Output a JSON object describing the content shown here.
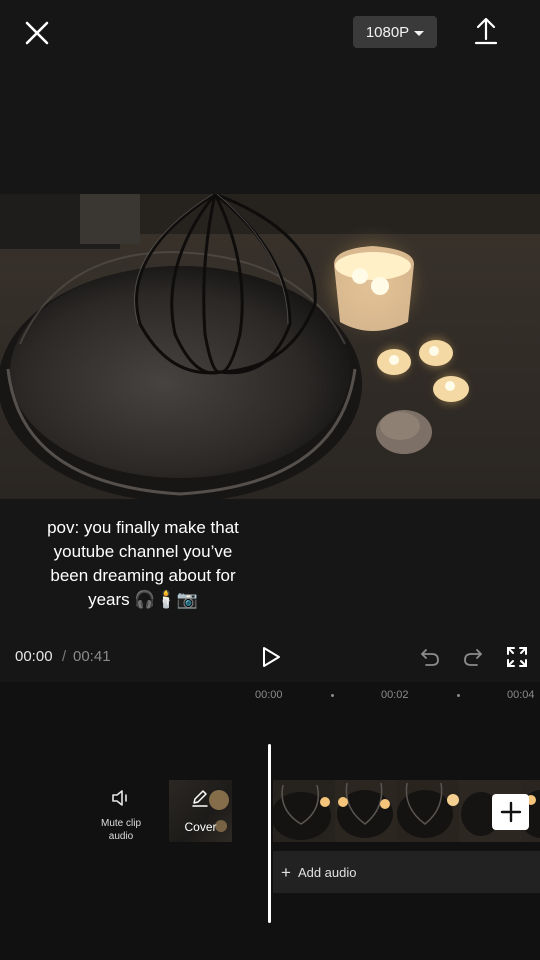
{
  "top_bar": {
    "close_icon": "close-icon",
    "quality_label": "1080P",
    "quality_icon": "caret-down-icon",
    "export_icon": "export-icon"
  },
  "preview": {
    "caption_lines": [
      "pov: you finally make that",
      "youtube channel you’ve",
      "been dreaming about for",
      "years 🎧🕯️📷"
    ]
  },
  "playback": {
    "current_time": "00:00",
    "separator": "/",
    "total_time": "00:41",
    "play_icon": "play-icon",
    "undo_icon": "undo-icon",
    "redo_icon": "redo-icon",
    "fullscreen_icon": "fullscreen-icon"
  },
  "timeline": {
    "ruler_labels": [
      "00:00",
      "00:02",
      "00:04"
    ],
    "mute_label_line1": "Mute clip",
    "mute_label_line2": "audio",
    "cover_label": "Cover",
    "add_audio_label": "Add audio",
    "add_clip_icon": "plus-icon"
  },
  "colors": {
    "background": "#161616",
    "timeline_bg": "#111111",
    "quality_btn": "#3a3a3a",
    "accent_white": "#ffffff"
  }
}
